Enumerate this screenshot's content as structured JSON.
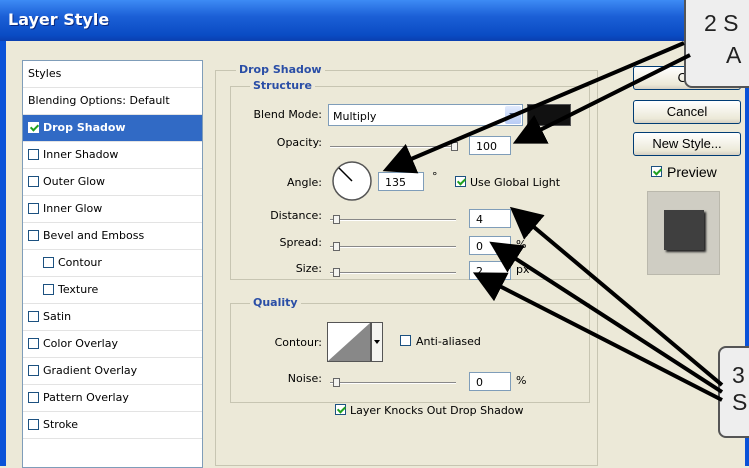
{
  "window": {
    "title": "Layer Style"
  },
  "styles_list": [
    {
      "label": "Styles",
      "type": "header"
    },
    {
      "label": "Blending Options: Default",
      "type": "header"
    },
    {
      "label": "Drop Shadow",
      "type": "check",
      "checked": true,
      "selected": true
    },
    {
      "label": "Inner Shadow",
      "type": "check",
      "checked": false
    },
    {
      "label": "Outer Glow",
      "type": "check",
      "checked": false
    },
    {
      "label": "Inner Glow",
      "type": "check",
      "checked": false
    },
    {
      "label": "Bevel and Emboss",
      "type": "check",
      "checked": false
    },
    {
      "label": "Contour",
      "type": "check",
      "checked": false,
      "indent": true
    },
    {
      "label": "Texture",
      "type": "check",
      "checked": false,
      "indent": true
    },
    {
      "label": "Satin",
      "type": "check",
      "checked": false
    },
    {
      "label": "Color Overlay",
      "type": "check",
      "checked": false
    },
    {
      "label": "Gradient Overlay",
      "type": "check",
      "checked": false
    },
    {
      "label": "Pattern Overlay",
      "type": "check",
      "checked": false
    },
    {
      "label": "Stroke",
      "type": "check",
      "checked": false
    }
  ],
  "drop_shadow": {
    "title": "Drop Shadow",
    "structure_title": "Structure",
    "blend_mode_label": "Blend Mode:",
    "blend_mode_value": "Multiply",
    "shadow_color": "#111111",
    "opacity_label": "Opacity:",
    "opacity_value": "100",
    "angle_label": "Angle:",
    "angle_value": "135",
    "degree_symbol": "°",
    "use_global_light_label": "Use Global Light",
    "use_global_light_checked": true,
    "distance_label": "Distance:",
    "distance_value": "4",
    "distance_unit": "px",
    "spread_label": "Spread:",
    "spread_value": "0",
    "spread_unit": "%",
    "size_label": "Size:",
    "size_value": "2",
    "size_unit": "px"
  },
  "quality": {
    "title": "Quality",
    "contour_label": "Contour:",
    "anti_aliased_label": "Anti-aliased",
    "anti_aliased_checked": false,
    "noise_label": "Noise:",
    "noise_value": "0",
    "noise_unit": "%"
  },
  "knockout": {
    "label": "Layer Knocks Out Drop Shadow",
    "checked": true
  },
  "buttons": {
    "ok": "OK",
    "cancel": "Cancel",
    "new_style": "New Style..."
  },
  "preview": {
    "label": "Preview",
    "checked": true
  },
  "callouts": {
    "top": {
      "line1": "2 S",
      "line2": "A"
    },
    "bottom": {
      "line1": "3 S",
      "line2": "S"
    }
  },
  "colors": {
    "title_bar": "#0a4cc4",
    "selected_row": "#316ac5",
    "group_title": "#2a4ea6"
  }
}
